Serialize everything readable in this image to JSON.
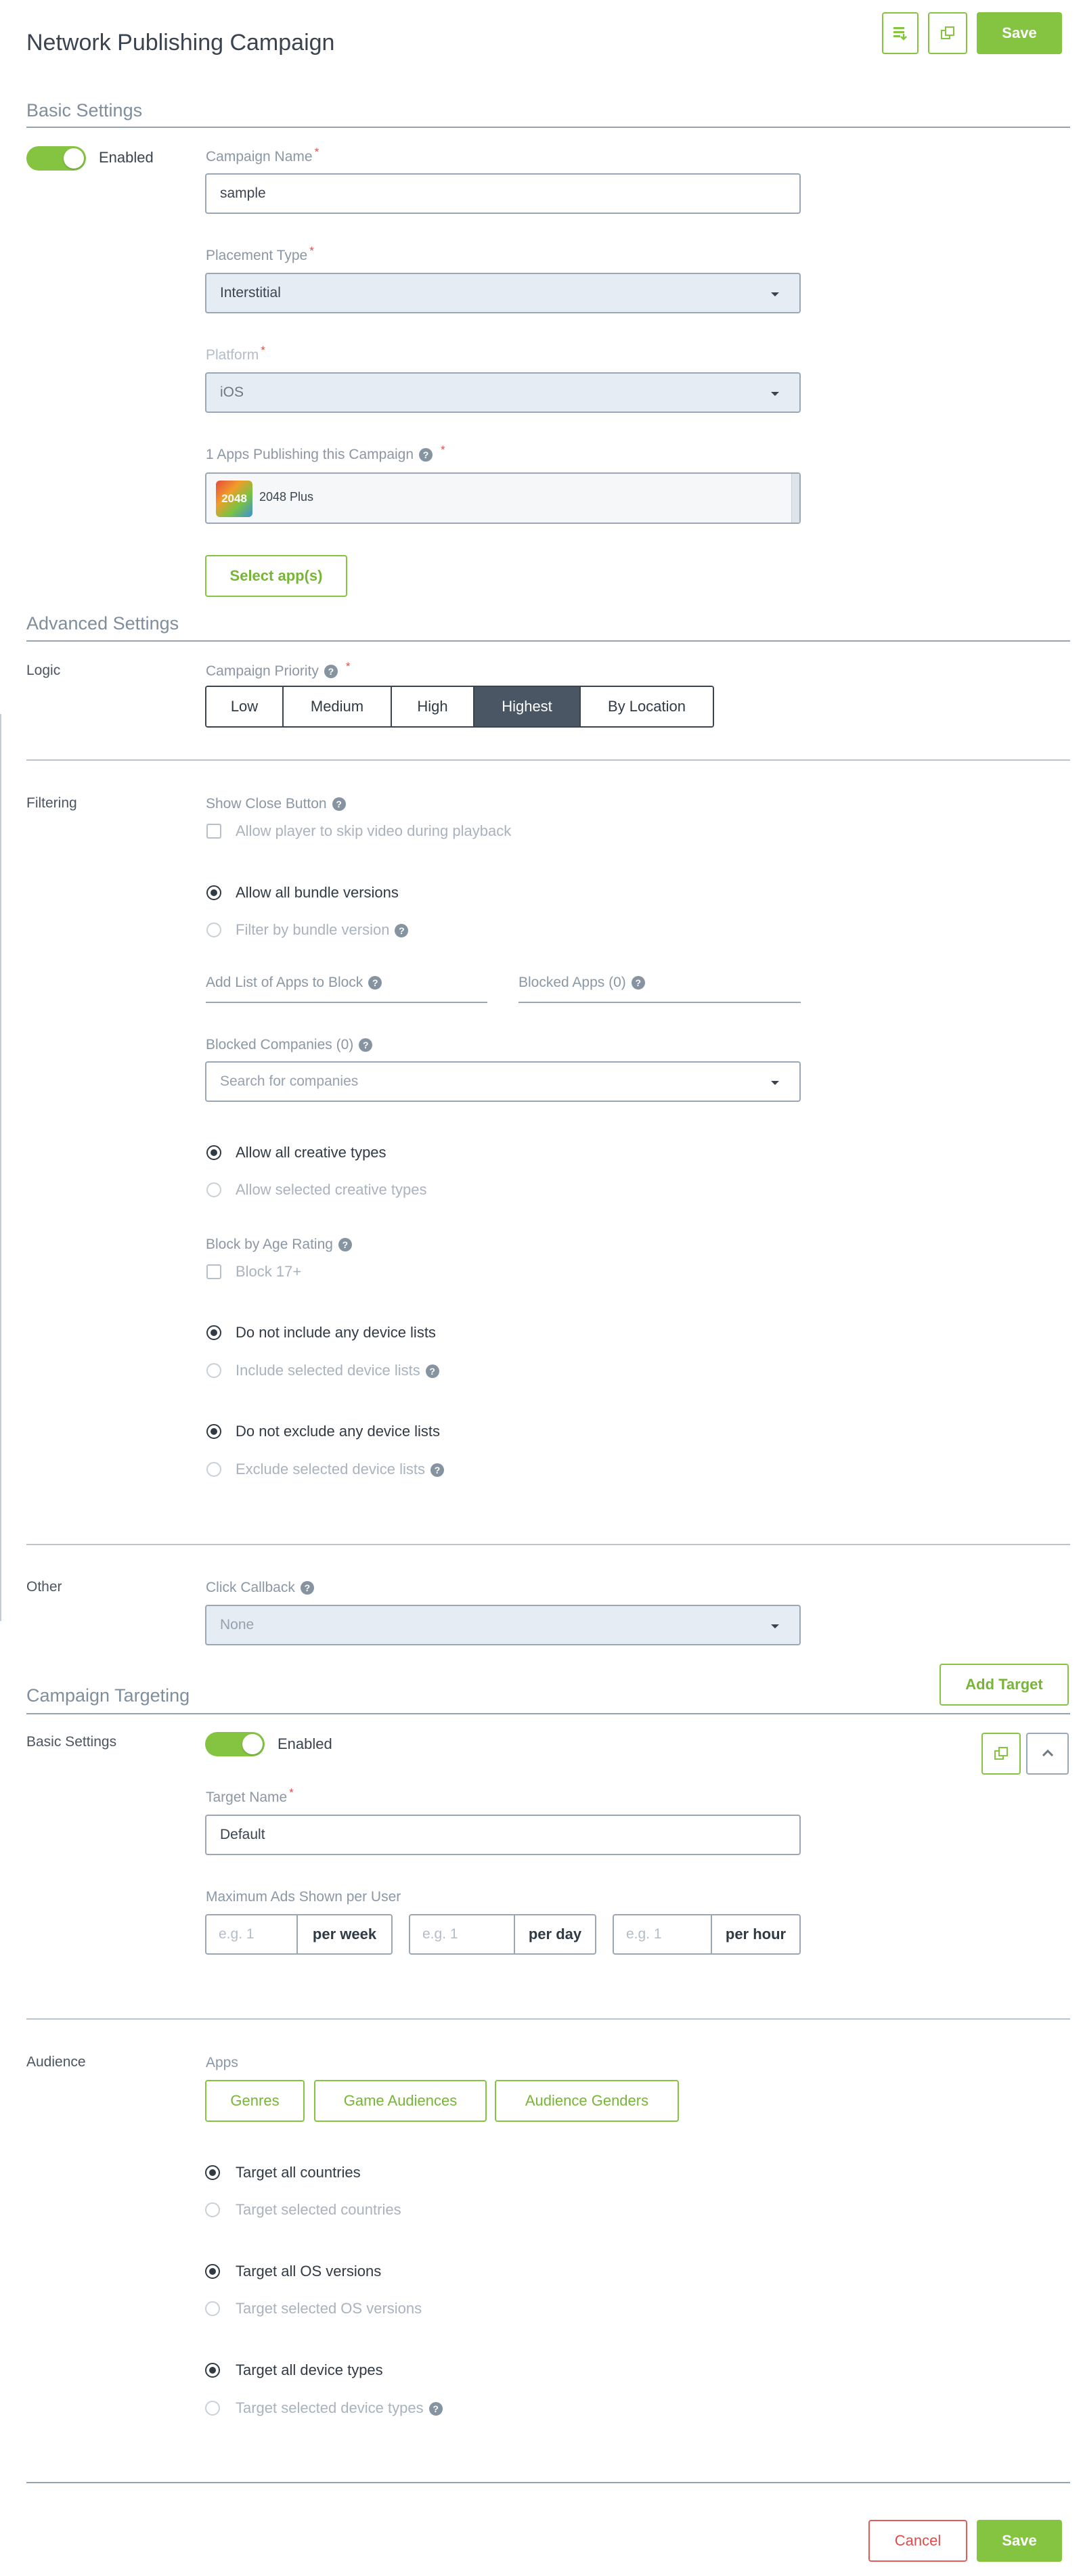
{
  "header": {
    "title": "Network Publishing Campaign",
    "save_label": "Save"
  },
  "basic": {
    "section_title": "Basic Settings",
    "enabled_label": "Enabled",
    "campaign_name_label": "Campaign Name",
    "campaign_name_value": "sample",
    "placement_type_label": "Placement Type",
    "placement_type_value": "Interstitial",
    "platform_label": "Platform",
    "platform_value": "iOS",
    "apps_label": "1 Apps Publishing this Campaign",
    "app_name": "2048 Plus",
    "app_icon_text": "2048",
    "select_apps_label": "Select app(s)",
    "required_mark": "*"
  },
  "advanced": {
    "section_title": "Advanced Settings",
    "logic_label": "Logic",
    "priority_label": "Campaign Priority",
    "priorities": [
      "Low",
      "Medium",
      "High",
      "Highest",
      "By Location"
    ],
    "filtering_label": "Filtering",
    "show_close_label": "Show Close Button",
    "skip_video_label": "Allow player to skip video during playback",
    "allow_bundle_label": "Allow all bundle versions",
    "filter_bundle_label": "Filter by bundle version",
    "add_list_label": "Add List of Apps to Block",
    "blocked_apps_label": "Blocked Apps (0)",
    "blocked_companies_label": "Blocked Companies (0)",
    "search_companies_placeholder": "Search for companies",
    "allow_creative_label": "Allow all creative types",
    "allow_selected_creative_label": "Allow selected creative types",
    "age_rating_label": "Block by Age Rating",
    "block17_label": "Block 17+",
    "no_include_device_label": "Do not include any device lists",
    "include_device_label": "Include selected device lists",
    "no_exclude_device_label": "Do not exclude any device lists",
    "exclude_device_label": "Exclude selected device lists",
    "other_label": "Other",
    "click_callback_label": "Click Callback",
    "click_callback_value": "None"
  },
  "targeting": {
    "section_title": "Campaign Targeting",
    "add_target_label": "Add Target",
    "basic_label": "Basic Settings",
    "enabled_label": "Enabled",
    "target_name_label": "Target Name",
    "target_name_value": "Default",
    "max_ads_label": "Maximum Ads Shown per User",
    "freq_placeholder": "e.g. 1",
    "per_week": "per week",
    "per_day": "per day",
    "per_hour": "per hour",
    "audience_label": "Audience",
    "apps_label": "Apps",
    "genres_label": "Genres",
    "game_audiences_label": "Game Audiences",
    "audience_genders_label": "Audience Genders",
    "all_countries_label": "Target all countries",
    "selected_countries_label": "Target selected countries",
    "all_os_label": "Target all OS versions",
    "selected_os_label": "Target selected OS versions",
    "all_devices_label": "Target all device types",
    "selected_devices_label": "Target selected device types"
  },
  "footer": {
    "cancel_label": "Cancel",
    "save_label": "Save"
  },
  "colors": {
    "accent": "#84c441",
    "danger": "#e34b4b",
    "text": "#2f3a45",
    "muted": "#8a97a5"
  },
  "icons": {
    "help": "question-circle-icon",
    "caret": "caret-down-icon",
    "copy": "copy-icon",
    "import": "import-list-icon",
    "collapse": "chevron-up-icon"
  }
}
